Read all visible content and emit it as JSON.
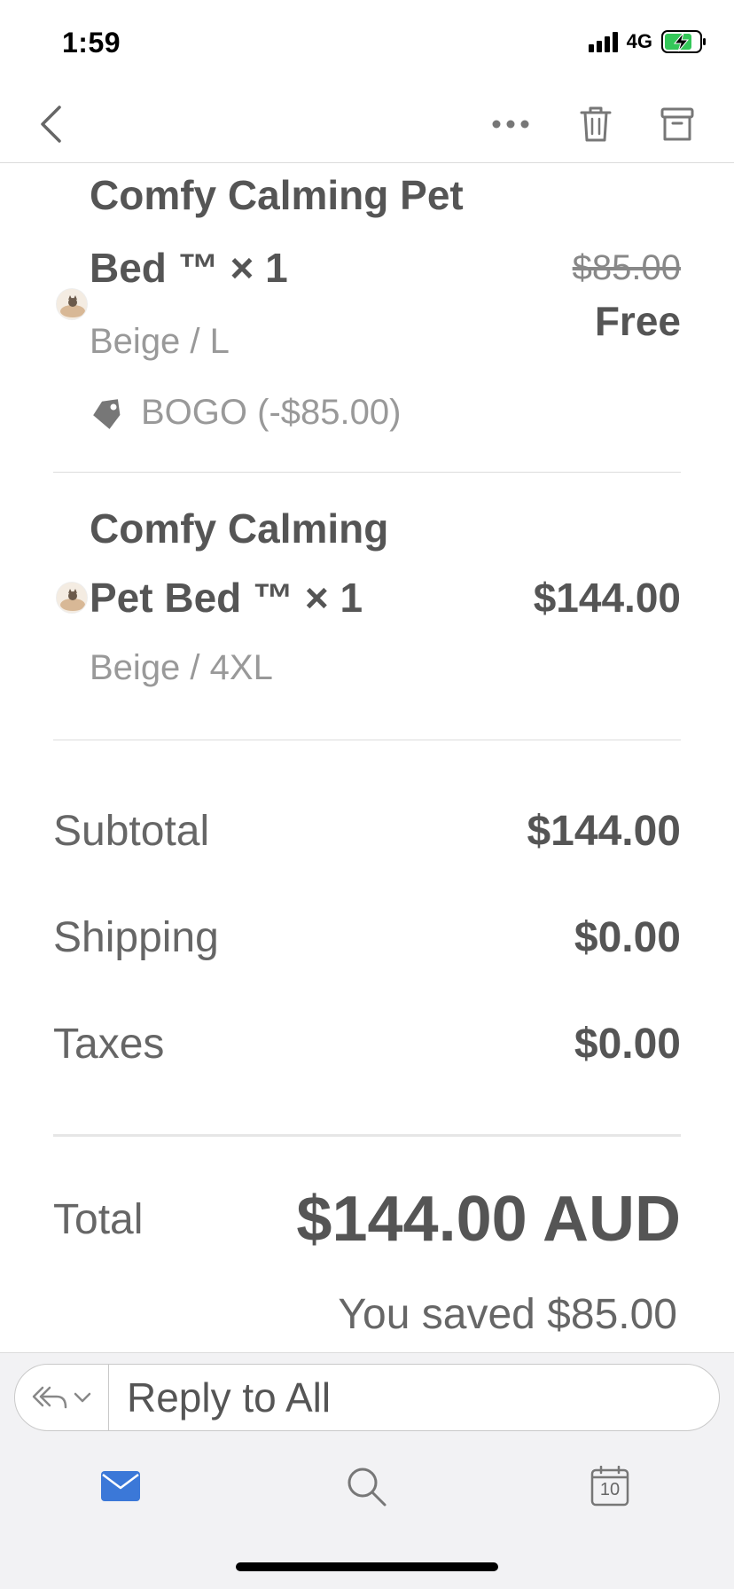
{
  "status_bar": {
    "time": "1:59",
    "network": "4G"
  },
  "items": [
    {
      "name_line1": "Comfy Calming Pet",
      "name_line2": "Bed ™ × 1",
      "variant": "Beige / L",
      "original_price": "$85.00",
      "price": "Free",
      "discount": "BOGO (-$85.00)"
    },
    {
      "name_line1": "Comfy Calming",
      "name_line2": "Pet Bed ™ × 1",
      "variant": "Beige / 4XL",
      "price": "$144.00"
    }
  ],
  "summary": {
    "subtotal_label": "Subtotal",
    "subtotal_value": "$144.00",
    "shipping_label": "Shipping",
    "shipping_value": "$0.00",
    "taxes_label": "Taxes",
    "taxes_value": "$0.00",
    "total_label": "Total",
    "total_value": "$144.00 AUD",
    "saved_text": "You saved $85.00"
  },
  "reply": {
    "placeholder": "Reply to All"
  },
  "tabs": {
    "calendar_day": "10"
  },
  "colors": {
    "accent": "#3b78d8",
    "text": "#555555",
    "muted": "#999999"
  }
}
